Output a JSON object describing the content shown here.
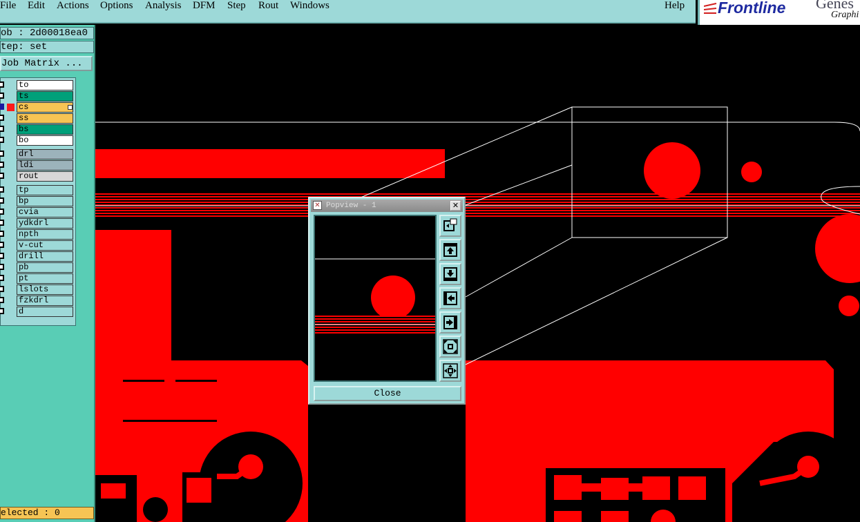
{
  "menubar": {
    "items": [
      "File",
      "Edit",
      "Actions",
      "Options",
      "Analysis",
      "DFM",
      "Step",
      "Rout",
      "Windows"
    ],
    "help": "Help"
  },
  "brand": {
    "logo_text": "Frontline",
    "genesis": "Genes",
    "graphics": "Graphi"
  },
  "left_panel": {
    "job": "ob : 2d00018ea0",
    "step": "tep: set",
    "job_matrix": "Job Matrix ...",
    "selected": "elected : 0"
  },
  "layers": [
    {
      "name": "to",
      "color": "#ffffff"
    },
    {
      "name": "ts",
      "color": "#00a07a"
    },
    {
      "name": "cs",
      "color": "#f6c454",
      "active": true
    },
    {
      "name": "ss",
      "color": "#f6c454"
    },
    {
      "name": "bs",
      "color": "#00a07a"
    },
    {
      "name": "bo",
      "color": "#ffffff"
    },
    {
      "name": "drl",
      "color": "#9cb3bb"
    },
    {
      "name": "ldi",
      "color": "#9cb3bb"
    },
    {
      "name": "rout",
      "color": "#d8d8d8"
    },
    {
      "name": "tp",
      "color": "#9dd9d8"
    },
    {
      "name": "bp",
      "color": "#9dd9d8"
    },
    {
      "name": "cvia",
      "color": "#9dd9d8"
    },
    {
      "name": "ydkdrl",
      "color": "#9dd9d8"
    },
    {
      "name": "npth",
      "color": "#9dd9d8"
    },
    {
      "name": "v-cut",
      "color": "#9dd9d8"
    },
    {
      "name": "drill",
      "color": "#9dd9d8"
    },
    {
      "name": "pb",
      "color": "#9dd9d8"
    },
    {
      "name": "pt",
      "color": "#9dd9d8"
    },
    {
      "name": "lslots",
      "color": "#9dd9d8"
    },
    {
      "name": "fzkdrl",
      "color": "#9dd9d8"
    },
    {
      "name": "d",
      "color": "#9dd9d8"
    }
  ],
  "popview": {
    "title": "Popview - 1",
    "close_label": "Close",
    "tools": [
      "zoom-home-icon",
      "move-up-icon",
      "move-down-icon",
      "move-left-icon",
      "move-right-icon",
      "zoom-out-icon",
      "zoom-in-icon"
    ]
  },
  "colors": {
    "copper": "#ff0000",
    "canvas": "#000000",
    "panel": "#59cdb5",
    "menu": "#9dd9d8",
    "brand": "#1e2aa0"
  }
}
